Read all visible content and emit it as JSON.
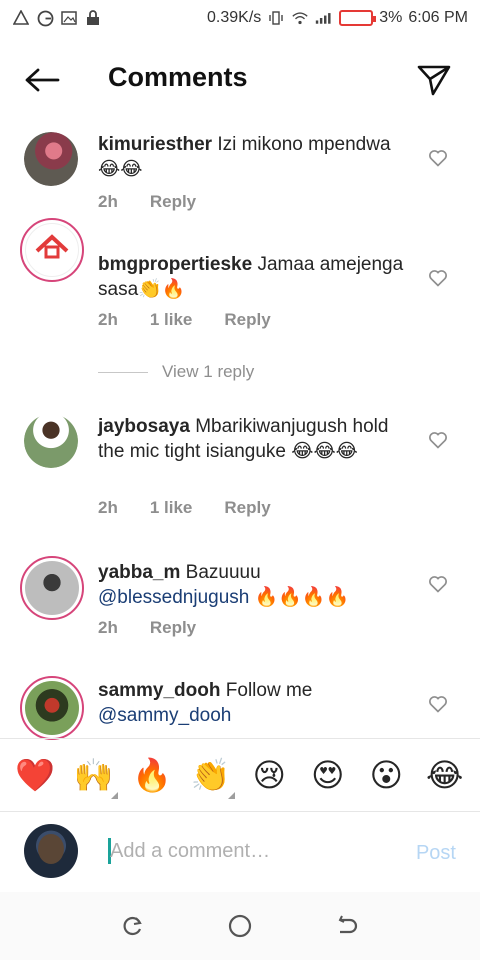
{
  "status": {
    "speed": "0.39K/s",
    "battery": "3%",
    "time": "6:06 PM"
  },
  "header": {
    "title": "Comments"
  },
  "comments": [
    {
      "username": "kimuriesther",
      "text": "Izi mikono mpendwa 😂😂",
      "mention": "",
      "time": "2h",
      "likes": "",
      "reply": "Reply"
    },
    {
      "username": "bmgpropertieske",
      "text": "Jamaa amejenga sasa👏🔥",
      "mention": "",
      "time": "2h",
      "likes": "1 like",
      "reply": "Reply"
    },
    {
      "username": "jaybosaya",
      "text": "Mbarikiwanjugush hold the mic tight isianguke 😂😂😂",
      "mention": "",
      "time": "2h",
      "likes": "1 like",
      "reply": "Reply"
    },
    {
      "username": "yabba_m",
      "text": "Bazuuuu",
      "mention": "@blessednjugush",
      "text_after": " 🔥🔥🔥🔥",
      "time": "2h",
      "likes": "",
      "reply": "Reply"
    },
    {
      "username": "sammy_dooh",
      "text": "Follow me",
      "mention": "@sammy_dooh",
      "time": "",
      "likes": "",
      "reply": ""
    }
  ],
  "view_reply": "View 1 reply",
  "emoji_bar": [
    "❤️",
    "🙌",
    "🔥",
    "👏",
    "😢",
    "😍",
    "😮",
    "😂"
  ],
  "comment_input": {
    "placeholder": "Add a comment…",
    "post_label": "Post"
  },
  "colors": {
    "accent_ring": "#d6457a",
    "mention": "#1b3e75",
    "post_disabled": "#b6d6f4",
    "muted": "#8e8e8e"
  }
}
